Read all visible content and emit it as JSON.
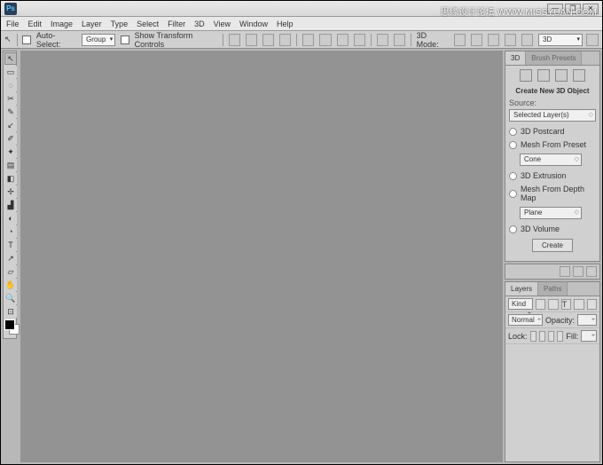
{
  "watermark": {
    "text": "思缘设计论坛 WWW.MISSYUAN.COM"
  },
  "titlebar": {
    "logo": "Ps"
  },
  "window_controls": {
    "minimize": "—",
    "restore": "❐",
    "close": "✕"
  },
  "menu": [
    "File",
    "Edit",
    "Image",
    "Layer",
    "Type",
    "Select",
    "Filter",
    "3D",
    "View",
    "Window",
    "Help"
  ],
  "options": {
    "tool_icon": "↖",
    "auto_select": "Auto-Select:",
    "group": "Group",
    "show_transform": "Show Transform Controls",
    "mode_label": "3D Mode:",
    "mode_value": "3D"
  },
  "tools": [
    "↖",
    "▭",
    "◌",
    "✂",
    "✎",
    "↙",
    "✐",
    "✦",
    "▤",
    "◧",
    "✢",
    "▟",
    "◐",
    "◔",
    "T",
    "↗",
    "▱",
    "✋",
    "🔍",
    "⊡"
  ],
  "panel_3d": {
    "tabs": [
      "3D",
      "Brush Presets"
    ],
    "title": "Create New 3D Object",
    "source_label": "Source:",
    "source_value": "Selected Layer(s)",
    "opts": [
      {
        "label": "3D Postcard"
      },
      {
        "label": "Mesh From Preset",
        "dd": "Cone"
      },
      {
        "label": "3D Extrusion"
      },
      {
        "label": "Mesh From Depth Map",
        "dd": "Plane"
      },
      {
        "label": "3D Volume"
      }
    ],
    "create": "Create"
  },
  "layers": {
    "tabs": [
      "Layers",
      "Paths"
    ],
    "kind": "Kind",
    "kind_dd": "",
    "blend": "Normal",
    "opacity_label": "Opacity:",
    "opacity": "",
    "lock": "Lock:",
    "fill_label": "Fill:",
    "fill": ""
  }
}
